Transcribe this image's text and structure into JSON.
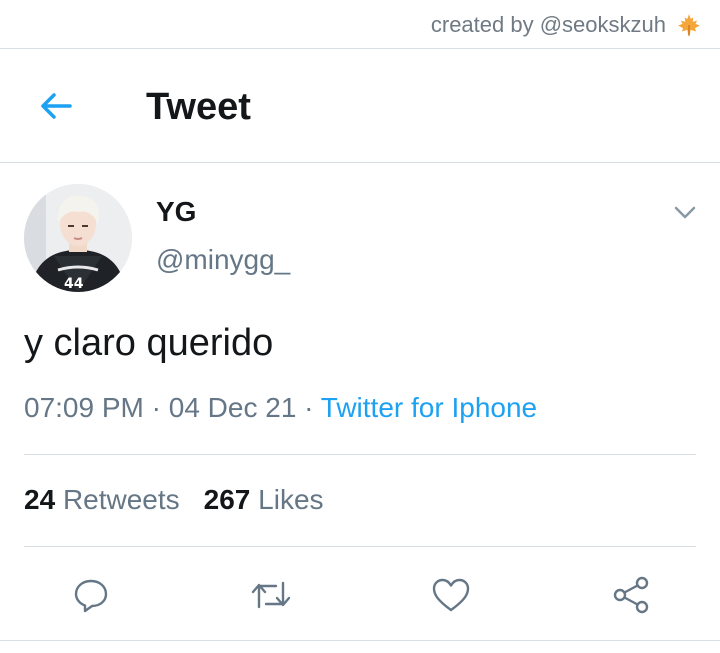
{
  "credit": {
    "text": "created by @seokskzuh",
    "icon": "maple-leaf-icon"
  },
  "header": {
    "title": "Tweet",
    "back_icon": "back-arrow-icon"
  },
  "tweet": {
    "author": {
      "display_name": "YG",
      "handle": "@minygg_"
    },
    "text": "y claro querido",
    "time": "07:09 PM",
    "separator": "·",
    "date": "04 Dec 21",
    "source": "Twitter for Iphone"
  },
  "stats": {
    "retweets_count": "24",
    "retweets_label": "Retweets",
    "likes_count": "267",
    "likes_label": "Likes"
  },
  "actions": [
    "reply-icon",
    "retweet-icon",
    "like-icon",
    "share-icon"
  ],
  "colors": {
    "accent": "#1da1f2",
    "text_primary": "#14171a",
    "text_secondary": "#657786",
    "divider": "#d8e0e6"
  }
}
